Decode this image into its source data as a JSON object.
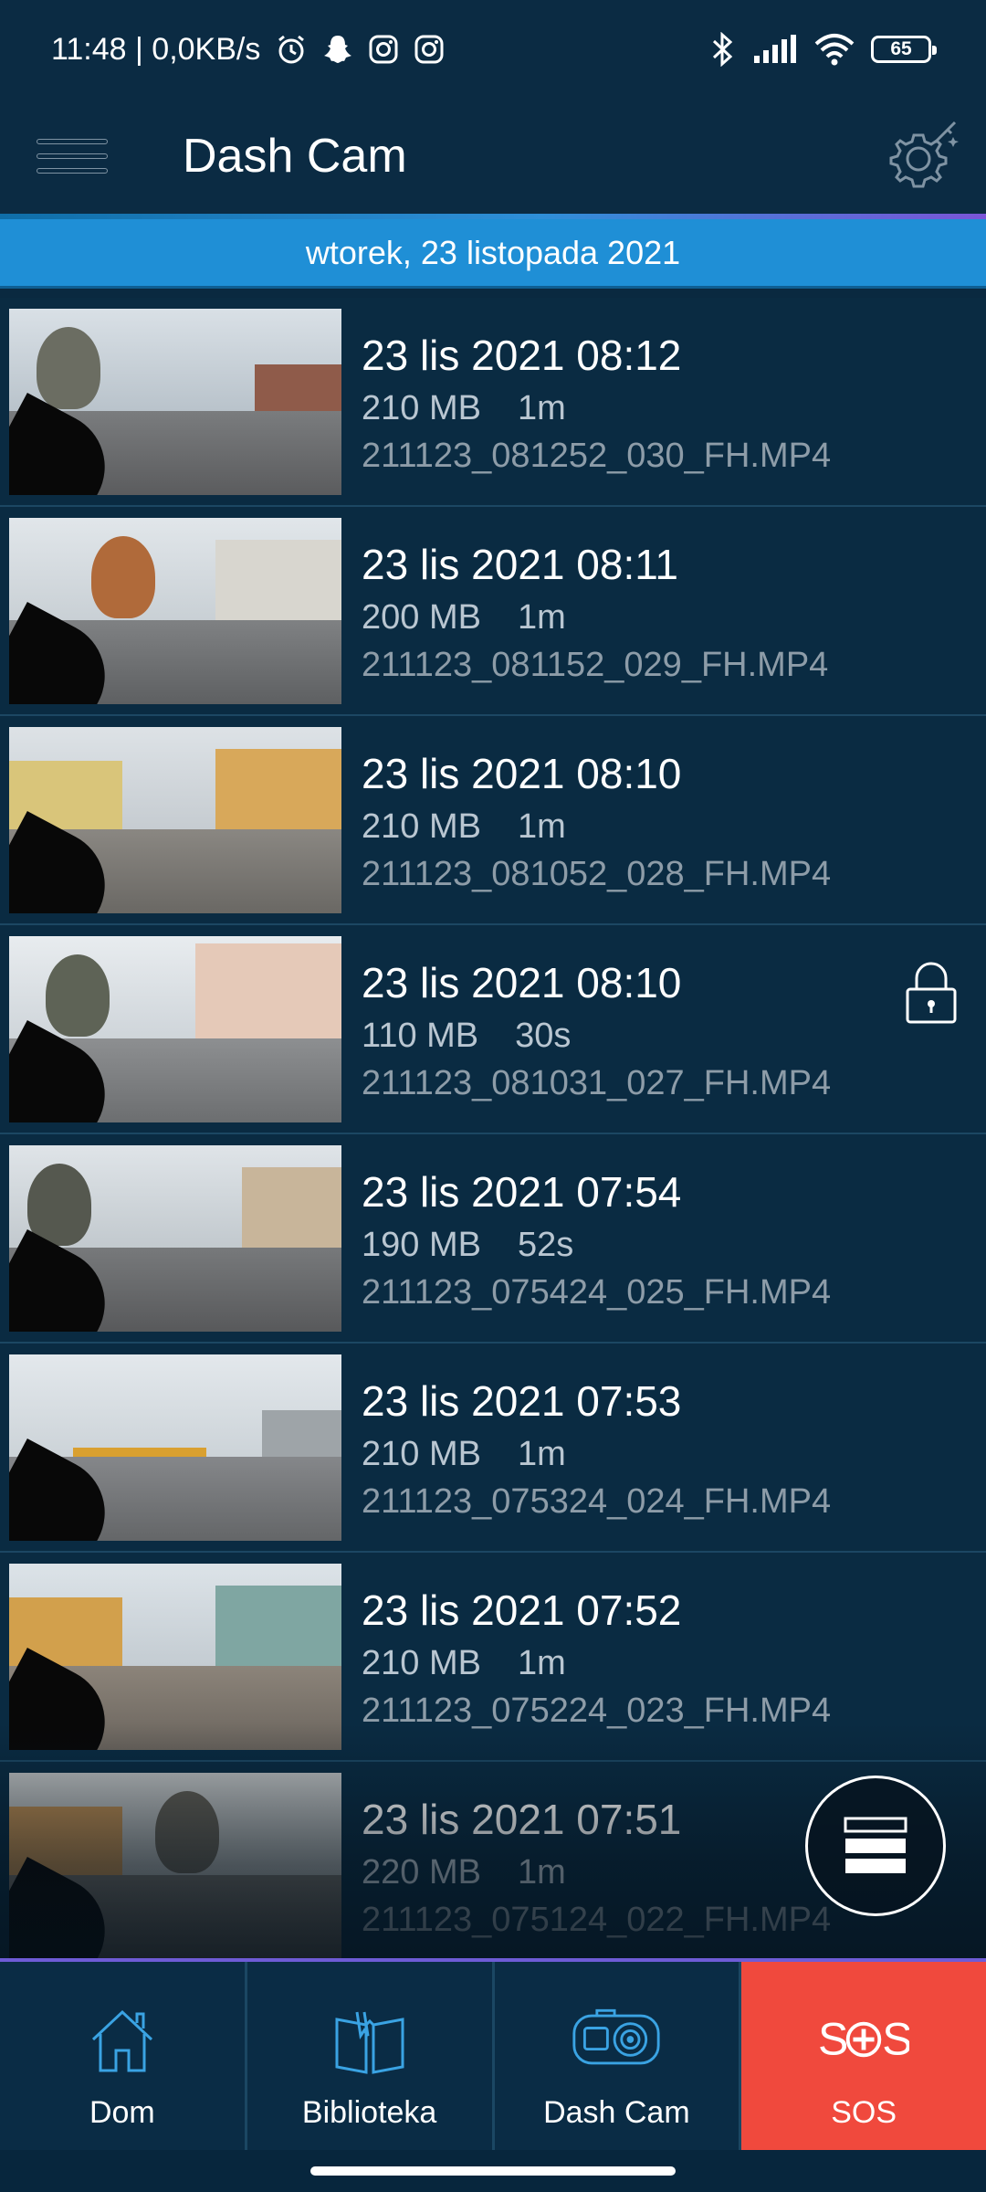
{
  "status_bar": {
    "time_speed": "11:48 | 0,0KB/s",
    "battery": "65",
    "icons": [
      "alarm-icon",
      "snapchat-icon",
      "instagram-icon",
      "instagram-icon",
      "bluetooth-icon",
      "signal-icon",
      "wifi-icon",
      "battery-icon"
    ]
  },
  "app_bar": {
    "title": "Dash Cam",
    "menu_icon": "hamburger-menu-icon",
    "settings_icon": "gear-sparkle-icon"
  },
  "date_header": "wtorek, 23 listopada 2021",
  "recordings": [
    {
      "title": "23 lis 2021 08:12",
      "size": "210 MB",
      "duration": "1m",
      "file": "211123_081252_030_FH.MP4",
      "locked": false
    },
    {
      "title": "23 lis 2021 08:11",
      "size": "200 MB",
      "duration": "1m",
      "file": "211123_081152_029_FH.MP4",
      "locked": false
    },
    {
      "title": "23 lis 2021 08:10",
      "size": "210 MB",
      "duration": "1m",
      "file": "211123_081052_028_FH.MP4",
      "locked": false
    },
    {
      "title": "23 lis 2021 08:10",
      "size": "110 MB",
      "duration": "30s",
      "file": "211123_081031_027_FH.MP4",
      "locked": true
    },
    {
      "title": "23 lis 2021 07:54",
      "size": "190 MB",
      "duration": "52s",
      "file": "211123_075424_025_FH.MP4",
      "locked": false
    },
    {
      "title": "23 lis 2021 07:53",
      "size": "210 MB",
      "duration": "1m",
      "file": "211123_075324_024_FH.MP4",
      "locked": false
    },
    {
      "title": "23 lis 2021 07:52",
      "size": "210 MB",
      "duration": "1m",
      "file": "211123_075224_023_FH.MP4",
      "locked": false
    },
    {
      "title": "23 lis 2021 07:51",
      "size": "220 MB",
      "duration": "1m",
      "file": "211123_075124_022_FH.MP4",
      "locked": false
    }
  ],
  "fab_icon": "view-toggle-icon",
  "bottom_nav": {
    "home": "Dom",
    "library": "Biblioteka",
    "dashcam": "Dash Cam",
    "sos": "SOS"
  },
  "colors": {
    "background": "#082539",
    "date_header": "#1f8fd6",
    "sos": "#f0493d",
    "accent_line": "#6e5bd6",
    "icon_blue": "#3aa3e3"
  }
}
